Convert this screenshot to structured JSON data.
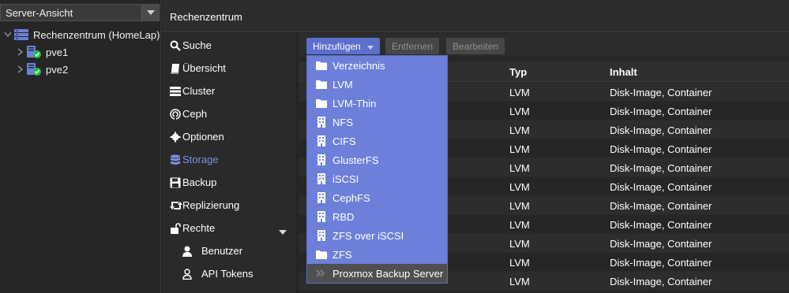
{
  "tree": {
    "view_select": "Server-Ansicht",
    "datacenter": "Rechenzentrum (HomeLap)",
    "nodes": [
      "pve1",
      "pve2"
    ]
  },
  "header": {
    "title": "Rechenzentrum"
  },
  "nav": {
    "items": [
      "Suche",
      "Übersicht",
      "Cluster",
      "Ceph",
      "Optionen",
      "Storage",
      "Backup",
      "Replizierung",
      "Rechte",
      "Benutzer",
      "API Tokens"
    ],
    "active": "Storage"
  },
  "toolbar": {
    "add": "Hinzufügen",
    "remove": "Entfernen",
    "edit": "Bearbeiten"
  },
  "grid": {
    "columns": [
      "Typ",
      "Inhalt"
    ],
    "rows": [
      {
        "id": "",
        "typ": "LVM",
        "inhalt": "Disk-Image, Container"
      },
      {
        "id": "",
        "typ": "LVM",
        "inhalt": "Disk-Image, Container"
      },
      {
        "id": "",
        "typ": "LVM",
        "inhalt": "Disk-Image, Container"
      },
      {
        "id": "",
        "typ": "LVM",
        "inhalt": "Disk-Image, Container"
      },
      {
        "id": "",
        "typ": "LVM",
        "inhalt": "Disk-Image, Container"
      },
      {
        "id": "",
        "typ": "LVM",
        "inhalt": "Disk-Image, Container"
      },
      {
        "id": "",
        "typ": "LVM",
        "inhalt": "Disk-Image, Container"
      },
      {
        "id": "",
        "typ": "LVM",
        "inhalt": "Disk-Image, Container"
      },
      {
        "id": "",
        "typ": "LVM",
        "inhalt": "Disk-Image, Container"
      },
      {
        "id": "",
        "typ": "LVM",
        "inhalt": "Disk-Image, Container"
      },
      {
        "id": "",
        "typ": "LVM",
        "inhalt": "Disk-Image, Container"
      }
    ]
  },
  "menu": {
    "items": [
      {
        "label": "Verzeichnis",
        "icon": "folder-icon"
      },
      {
        "label": "LVM",
        "icon": "folder-icon"
      },
      {
        "label": "LVM-Thin",
        "icon": "folder-icon"
      },
      {
        "label": "NFS",
        "icon": "building-icon"
      },
      {
        "label": "CIFS",
        "icon": "building-icon"
      },
      {
        "label": "GlusterFS",
        "icon": "building-icon"
      },
      {
        "label": "iSCSI",
        "icon": "building-icon"
      },
      {
        "label": "CephFS",
        "icon": "building-icon"
      },
      {
        "label": "RBD",
        "icon": "building-icon"
      },
      {
        "label": "ZFS over iSCSI",
        "icon": "building-icon"
      },
      {
        "label": "ZFS",
        "icon": "folder-icon"
      },
      {
        "label": "Proxmox Backup Server",
        "icon": "pbs-icon"
      }
    ]
  },
  "colors": {
    "accent": "#6d7fd9",
    "active_nav": "#7f8fe4",
    "online": "#21bf4b"
  }
}
